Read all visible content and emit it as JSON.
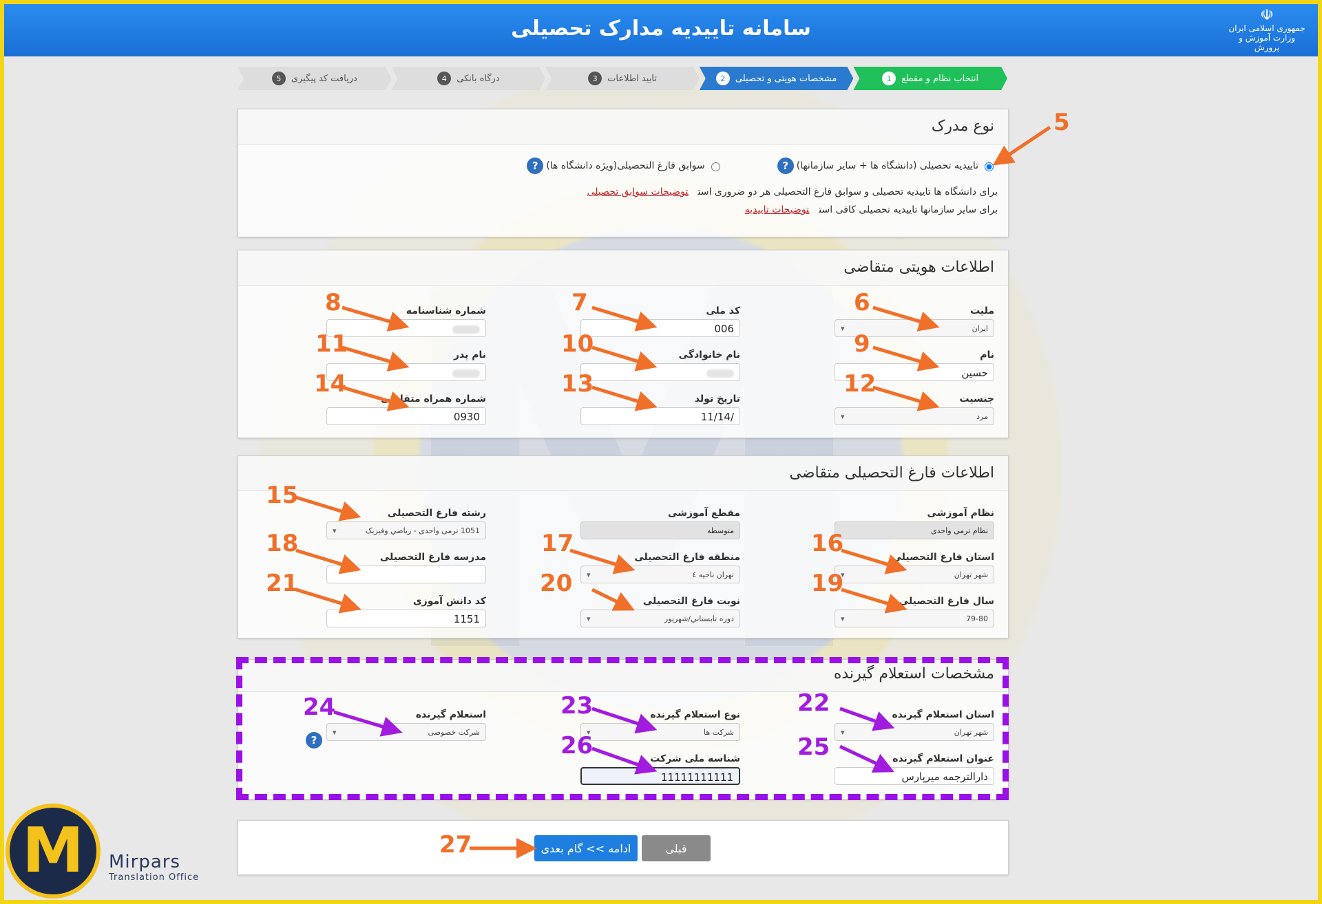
{
  "header": {
    "title": "سامانه تاییدیه مدارک تحصیلی",
    "emblem_line1": "جمهوری اسلامی ایران",
    "emblem_line2": "وزارت آموزش و پرورش"
  },
  "steps": [
    {
      "num": "1",
      "label": "انتخاب نظام و مقطع"
    },
    {
      "num": "2",
      "label": "مشخصات هویتی و تحصیلی"
    },
    {
      "num": "3",
      "label": "تایید اطلاعات"
    },
    {
      "num": "4",
      "label": "درگاه بانکی"
    },
    {
      "num": "5",
      "label": "دریافت کد پیگیری"
    }
  ],
  "doc_type": {
    "title": "نوع مدرک",
    "option1": "تاییدیه تحصیلی (دانشگاه ها + سایر سازمانها)",
    "option2": "سوابق فارغ التحصیلی(ویژه دانشگاه ها)",
    "note1": "برای دانشگاه ها تاییدیه تحصیلی و سوابق فارغ التحصیلی هر دو ضروری است",
    "note1_link": "توضیحات سوابق تحصیلی",
    "note2": "برای سایر سازمانها تاییدیه تحصیلی کافی است",
    "note2_link": "توضیحات تاییدیه"
  },
  "identity": {
    "title": "اطلاعات هویتی متقاضی",
    "nationality_label": "ملیت",
    "nationality_value": "ایران",
    "national_code_label": "کد ملی",
    "national_code_value": "006",
    "id_number_label": "شماره شناسنامه",
    "first_name_label": "نام",
    "first_name_value": "حسین",
    "last_name_label": "نام خانوادگی",
    "father_name_label": "نام پدر",
    "gender_label": "جنسیت",
    "gender_value": "مرد",
    "birth_date_label": "تاریخ تولد",
    "birth_date_value": "/11/14",
    "mobile_label": "شماره همراه متقاضی",
    "mobile_value": "0930"
  },
  "graduation": {
    "title": "اطلاعات فارغ التحصیلی متقاضی",
    "system_label": "نظام آموزشی",
    "system_value": "نظام ترمی واحدی",
    "level_label": "مقطع آموزشی",
    "level_value": "متوسطه",
    "field_label": "رشته فارغ التحصیلی",
    "field_value": "1051 ترمی واحدی - رياضي وفيزيک",
    "province_label": "استان فارغ التحصیلی",
    "province_value": "شهر تهران",
    "region_label": "منطقه فارغ التحصیلی",
    "region_value": "تهران ناحيه ٤",
    "school_label": "مدرسه فارغ التحصیلی",
    "year_label": "سال فارغ التحصیلی",
    "year_value": "79-80",
    "term_label": "نوبت فارغ التحصیلی",
    "term_value": "دوره تابستاني/شهريور",
    "student_code_label": "کد دانش آموزی",
    "student_code_value": "1151"
  },
  "inquirer": {
    "title": "مشخصات استعلام گیرنده",
    "province_label": "استان استعلام گیرنده",
    "province_value": "شهر تهران",
    "type_label": "نوع استعلام گیرنده",
    "type_value": "شرکت ها",
    "inquirer_label": "استعلام گیرنده",
    "inquirer_value": "شرکت خصوصی",
    "name_label": "عنوان استعلام گیرنده",
    "name_value": "دارالترجمه میرپارس",
    "company_id_label": "شناسه ملی شرکت",
    "company_id_value": "11111111111"
  },
  "buttons": {
    "next": "ادامه >> گام بعدی",
    "prev": "قبلی"
  },
  "callouts": [
    "5",
    "6",
    "7",
    "8",
    "9",
    "10",
    "11",
    "12",
    "13",
    "14",
    "15",
    "16",
    "17",
    "18",
    "19",
    "20",
    "21",
    "22",
    "23",
    "24",
    "25",
    "26",
    "27"
  ],
  "brand": {
    "name": "Mirpars",
    "sub": "Translation Office",
    "logo_letter": "M"
  },
  "help_glyph": "?",
  "colors": {
    "header": "#1a6fd6",
    "step_done": "#1fc05a",
    "step_active": "#2a7bcf",
    "callout_orange": "#f0702a",
    "callout_purple": "#a21ce0",
    "frame": "#f2d516",
    "next_button": "#1f7fe0",
    "prev_button": "#8a8a8a"
  }
}
